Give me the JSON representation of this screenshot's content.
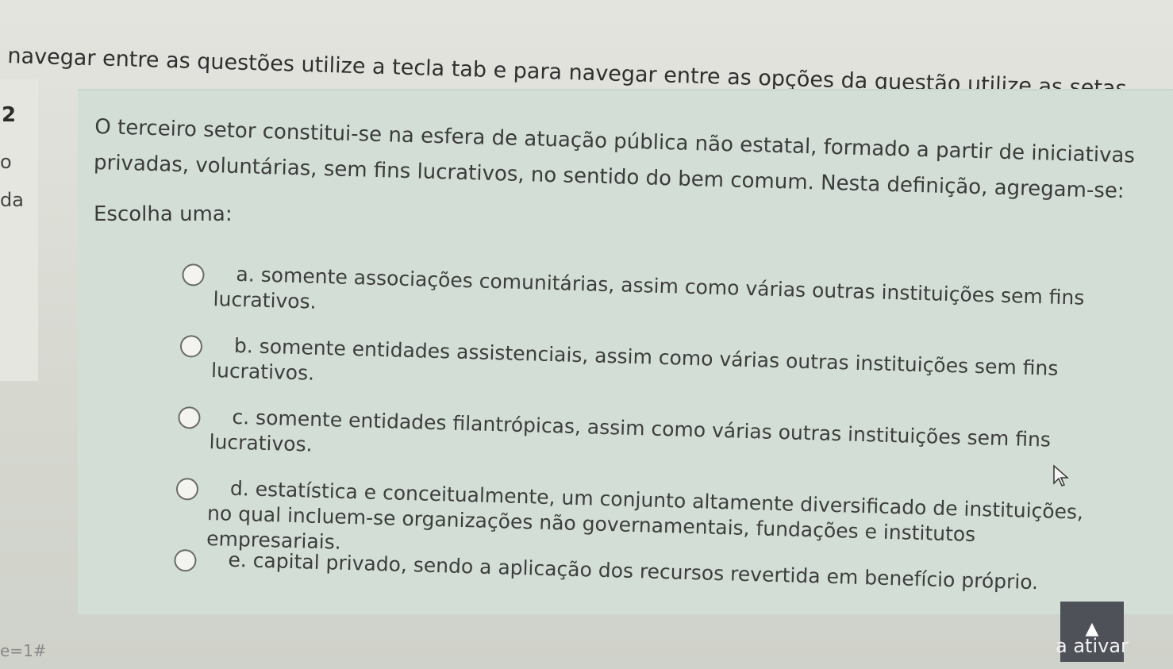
{
  "instruction": "navegar entre as questões utilize a tecla tab e para navegar entre as opções da questão utilize as setas.",
  "question_info": {
    "number": "2",
    "status": "o",
    "grade": "da"
  },
  "question": {
    "text": "O terceiro setor constitui-se na esfera de atuação pública não estatal, formado a partir de iniciativas privadas, voluntárias, sem fins lucrativos, no sentido do bem comum. Nesta definição, agregam-se:",
    "choose_label": "Escolha uma:",
    "options": [
      {
        "letter": "a.",
        "text": "somente associações comunitárias, assim como várias outras instituições sem fins lucrativos."
      },
      {
        "letter": "b.",
        "text": "somente entidades assistenciais, assim como várias outras instituições sem fins lucrativos."
      },
      {
        "letter": "c.",
        "text": "somente entidades filantrópicas, assim como várias outras instituições sem fins lucrativos."
      },
      {
        "letter": "d.",
        "text": "estatística e conceitualmente, um conjunto altamente diversificado de instituições, no qual incluem-se organizações não governamentais, fundações e institutos empresariais."
      },
      {
        "letter": "e.",
        "text": "capital privado, sendo a aplicação dos recursos revertida em benefício próprio."
      }
    ]
  },
  "footer": {
    "shortcut": "e=1#"
  },
  "windows_watermark": "a ativar",
  "icons": {
    "scroll_top": "chevron-up-icon",
    "cursor": "mouse-cursor-icon"
  },
  "colors": {
    "panel": "#d3dfd6",
    "scroll_button": "#4e5158"
  }
}
